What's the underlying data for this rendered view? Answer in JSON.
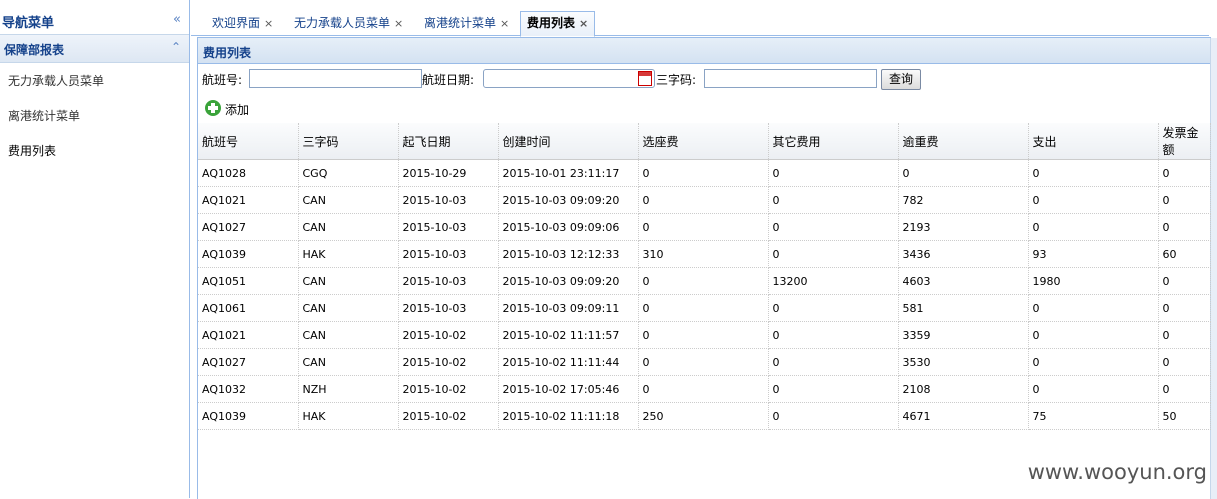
{
  "sidebar": {
    "title": "导航菜单",
    "collapse_glyph": "«",
    "group": {
      "title": "保障部报表",
      "toggle_glyph": "⌃"
    },
    "items": [
      {
        "label": "无力承载人员菜单"
      },
      {
        "label": "离港统计菜单"
      },
      {
        "label": "费用列表"
      }
    ]
  },
  "tabs": [
    {
      "label": "欢迎界面",
      "close": "×"
    },
    {
      "label": "无力承载人员菜单",
      "close": "×"
    },
    {
      "label": "离港统计菜单",
      "close": "×"
    },
    {
      "label": "费用列表",
      "close": "×",
      "active": true
    }
  ],
  "panel": {
    "title": "费用列表"
  },
  "search": {
    "flight_label": "航班号:",
    "flight_value": "",
    "date_label": "航班日期:",
    "date_value": "",
    "code_label": "三字码:",
    "code_value": "",
    "query_label": "查询",
    "add_label": "添加"
  },
  "table": {
    "columns": [
      "航班号",
      "三字码",
      "起飞日期",
      "创建时间",
      "选座费",
      "其它费用",
      "逾重费",
      "支出",
      "发票金额"
    ],
    "rows": [
      [
        "AQ1028",
        "CGQ",
        "2015-10-29",
        "2015-10-01 23:11:17",
        "0",
        "0",
        "0",
        "0",
        "0"
      ],
      [
        "AQ1021",
        "CAN",
        "2015-10-03",
        "2015-10-03 09:09:20",
        "0",
        "0",
        "782",
        "0",
        "0"
      ],
      [
        "AQ1027",
        "CAN",
        "2015-10-03",
        "2015-10-03 09:09:06",
        "0",
        "0",
        "2193",
        "0",
        "0"
      ],
      [
        "AQ1039",
        "HAK",
        "2015-10-03",
        "2015-10-03 12:12:33",
        "310",
        "0",
        "3436",
        "93",
        "60"
      ],
      [
        "AQ1051",
        "CAN",
        "2015-10-03",
        "2015-10-03 09:09:20",
        "0",
        "13200",
        "4603",
        "1980",
        "0"
      ],
      [
        "AQ1061",
        "CAN",
        "2015-10-03",
        "2015-10-03 09:09:11",
        "0",
        "0",
        "581",
        "0",
        "0"
      ],
      [
        "AQ1021",
        "CAN",
        "2015-10-02",
        "2015-10-02 11:11:57",
        "0",
        "0",
        "3359",
        "0",
        "0"
      ],
      [
        "AQ1027",
        "CAN",
        "2015-10-02",
        "2015-10-02 11:11:44",
        "0",
        "0",
        "3530",
        "0",
        "0"
      ],
      [
        "AQ1032",
        "NZH",
        "2015-10-02",
        "2015-10-02 17:05:46",
        "0",
        "0",
        "2108",
        "0",
        "0"
      ],
      [
        "AQ1039",
        "HAK",
        "2015-10-02",
        "2015-10-02 11:11:18",
        "250",
        "0",
        "4671",
        "75",
        "50"
      ]
    ]
  },
  "watermark": "www.wooyun.org"
}
